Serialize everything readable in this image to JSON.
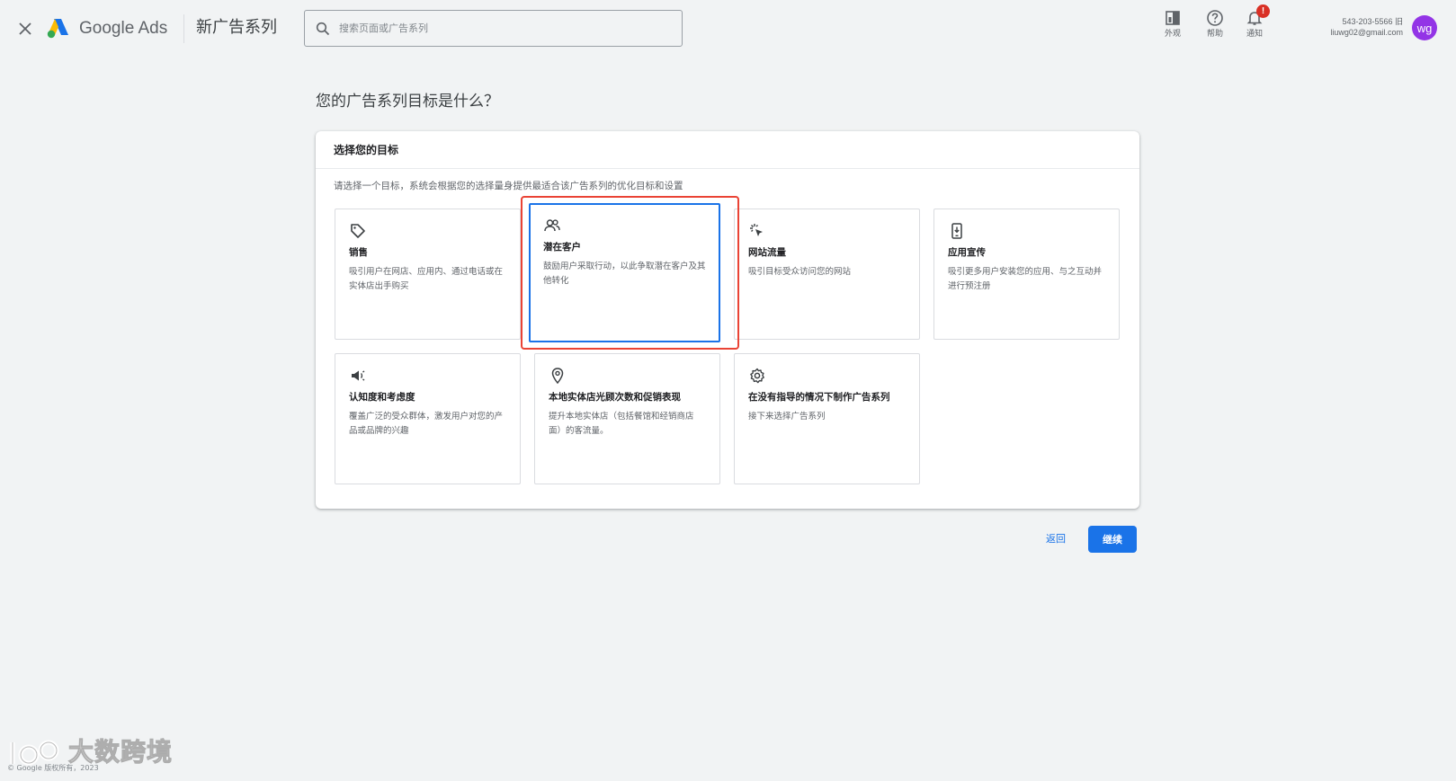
{
  "header": {
    "brand": "Google Ads",
    "campaign_title": "新广告系列",
    "search_placeholder": "搜索页面或广告系列",
    "actions": {
      "appearance": "外观",
      "help": "帮助",
      "notifications": "通知",
      "notification_count": "!"
    },
    "account": {
      "id": "543-203-5566 旧",
      "email": "liuwg02@gmail.com",
      "avatar_initials": "wg",
      "avatar_color": "#9334e6"
    }
  },
  "main": {
    "page_title": "您的广告系列目标是什么？",
    "card_header": "选择您的目标",
    "description": "请选择一个目标，系统会根据您的选择量身提供最适合该广告系列的优化目标和设置",
    "goals": [
      {
        "icon": "tag-icon",
        "title": "销售",
        "desc": "吸引用户在网店、应用内、通过电话或在实体店出手购买",
        "selected": false
      },
      {
        "icon": "people-icon",
        "title": "潜在客户",
        "desc": "鼓励用户采取行动，以此争取潜在客户及其他转化",
        "selected": true
      },
      {
        "icon": "cursor-click-icon",
        "title": "网站流量",
        "desc": "吸引目标受众访问您的网站",
        "selected": false
      },
      {
        "icon": "phone-download-icon",
        "title": "应用宣传",
        "desc": "吸引更多用户安装您的应用、与之互动并进行预注册",
        "selected": false
      },
      {
        "icon": "megaphone-icon",
        "title": "认知度和考虑度",
        "desc": "覆盖广泛的受众群体，激发用户对您的产品或品牌的兴趣",
        "selected": false
      },
      {
        "icon": "location-pin-icon",
        "title": "本地实体店光顾次数和促销表现",
        "desc": "提升本地实体店（包括餐馆和经销商店面）的客流量。",
        "selected": false
      },
      {
        "icon": "gear-icon",
        "title": "在没有指导的情况下制作广告系列",
        "desc": "接下来选择广告系列",
        "selected": false
      }
    ],
    "back_label": "返回",
    "continue_label": "继续"
  },
  "footer": {
    "copyright": "© Google 版权所有，2023",
    "watermark": "大数跨境"
  },
  "colors": {
    "primary": "#1a73e8",
    "highlight": "#ea4335",
    "background": "#f1f3f4"
  }
}
